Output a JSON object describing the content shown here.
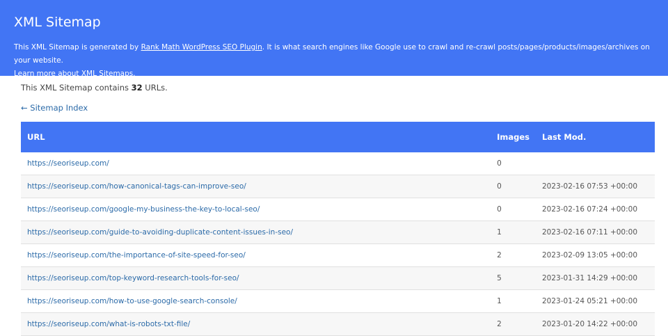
{
  "header": {
    "title": "XML Sitemap",
    "desc_1": "This XML Sitemap is generated by ",
    "plugin_link": "Rank Math WordPress SEO Plugin",
    "desc_2": ". It is what search engines like Google use to crawl and re-crawl posts/pages/products/images/archives on your website.",
    "learn_prefix": "Learn more about ",
    "learn_link": "XML Sitemaps",
    "learn_suffix": "."
  },
  "summary": {
    "prefix": "This XML Sitemap contains ",
    "count": "32",
    "suffix": " URLs."
  },
  "back_link": "← Sitemap Index",
  "table": {
    "headers": {
      "url": "URL",
      "images": "Images",
      "last_mod": "Last Mod."
    },
    "rows": [
      {
        "url": "https://seoriseup.com/",
        "images": "0",
        "last_mod": ""
      },
      {
        "url": "https://seoriseup.com/how-canonical-tags-can-improve-seo/",
        "images": "0",
        "last_mod": "2023-02-16 07:53 +00:00"
      },
      {
        "url": "https://seoriseup.com/google-my-business-the-key-to-local-seo/",
        "images": "0",
        "last_mod": "2023-02-16 07:24 +00:00"
      },
      {
        "url": "https://seoriseup.com/guide-to-avoiding-duplicate-content-issues-in-seo/",
        "images": "1",
        "last_mod": "2023-02-16 07:11 +00:00"
      },
      {
        "url": "https://seoriseup.com/the-importance-of-site-speed-for-seo/",
        "images": "2",
        "last_mod": "2023-02-09 13:05 +00:00"
      },
      {
        "url": "https://seoriseup.com/top-keyword-research-tools-for-seo/",
        "images": "5",
        "last_mod": "2023-01-31 14:29 +00:00"
      },
      {
        "url": "https://seoriseup.com/how-to-use-google-search-console/",
        "images": "1",
        "last_mod": "2023-01-24 05:21 +00:00"
      },
      {
        "url": "https://seoriseup.com/what-is-robots-txt-file/",
        "images": "2",
        "last_mod": "2023-01-20 14:22 +00:00"
      }
    ]
  },
  "colors": {
    "header_bg": "#4275f4",
    "link": "#2b6aa8"
  }
}
